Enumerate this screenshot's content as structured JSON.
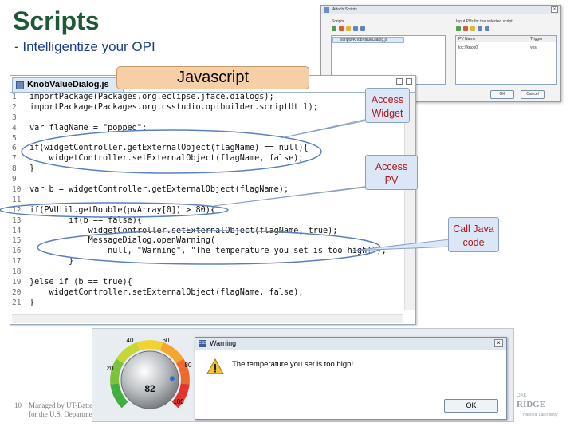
{
  "slide": {
    "title": "Scripts",
    "subtitle": "- Intelligentize your OPI",
    "page_number": "10",
    "footer_line1": "Managed by UT-Batte",
    "footer_line2": "for the U.S. Departme"
  },
  "attach_dialog": {
    "window_title": "Attach Scripts",
    "scripts_label": "Scripts",
    "pv_label": "Input PVs for the selected script:",
    "script_item": "scripts/KnobValueDialog.js",
    "col_pv_name": "PV Name",
    "col_trigger": "Trigger",
    "pv_value": "loc://knob0",
    "trigger_value": "yes",
    "ok_label": "OK",
    "cancel_label": "Cancel"
  },
  "editor": {
    "tab_label": "KnobValueDialog.js",
    "code_lines": [
      {
        "n": "1",
        "t": "importPackage(Packages.org.eclipse.jface.dialogs);"
      },
      {
        "n": "2",
        "t": "importPackage(Packages.org.csstudio.opibuilder.scriptUtil);"
      },
      {
        "n": "3",
        "t": ""
      },
      {
        "n": "4",
        "t": "var flagName = \"popped\";"
      },
      {
        "n": "5",
        "t": ""
      },
      {
        "n": "6",
        "t": "if(widgetController.getExternalObject(flagName) == null){"
      },
      {
        "n": "7",
        "t": "    widgetController.setExternalObject(flagName, false);"
      },
      {
        "n": "8",
        "t": "}"
      },
      {
        "n": "9",
        "t": ""
      },
      {
        "n": "10",
        "t": "var b = widgetController.getExternalObject(flagName);"
      },
      {
        "n": "11",
        "t": ""
      },
      {
        "n": "12",
        "t": "if(PVUtil.getDouble(pvArray[0]) > 80){"
      },
      {
        "n": "13",
        "t": "        if(b == false){"
      },
      {
        "n": "14",
        "t": "            widgetController.setExternalObject(flagName, true);"
      },
      {
        "n": "15",
        "t": "            MessageDialog.openWarning("
      },
      {
        "n": "16",
        "t": "                null, \"Warning\", \"The temperature you set is too high!\");"
      },
      {
        "n": "17",
        "t": "        }"
      },
      {
        "n": "18",
        "t": ""
      },
      {
        "n": "19",
        "t": "}else if (b == true){"
      },
      {
        "n": "20",
        "t": "    widgetController.setExternalObject(flagName, false);"
      },
      {
        "n": "21",
        "t": "}"
      }
    ]
  },
  "labels": {
    "javascript": "Javascript",
    "access_widget": [
      "Access",
      "Widget"
    ],
    "access_pv": [
      "Access",
      "PV"
    ],
    "call_java": [
      "Call Java",
      "code"
    ]
  },
  "knob": {
    "value": "82",
    "value_fraction": 0.82,
    "scale_labels": [
      "20",
      "40",
      "60",
      "80",
      "100"
    ]
  },
  "warning_dialog": {
    "title": "Warning",
    "message": "The temperature you set is too high!",
    "ok_label": "OK"
  },
  "logo": {
    "line1": "OAK",
    "line2": "RIDGE",
    "line3": "National Laboratory"
  },
  "colors": {
    "title": "#1d5a33",
    "subtitle": "#1a3e8c",
    "callout_fill": "#dbe6f6",
    "callout_text": "#b01818",
    "javascript_fill": "#f6cfa6",
    "ellipse_stroke": "#5a7fc0"
  }
}
